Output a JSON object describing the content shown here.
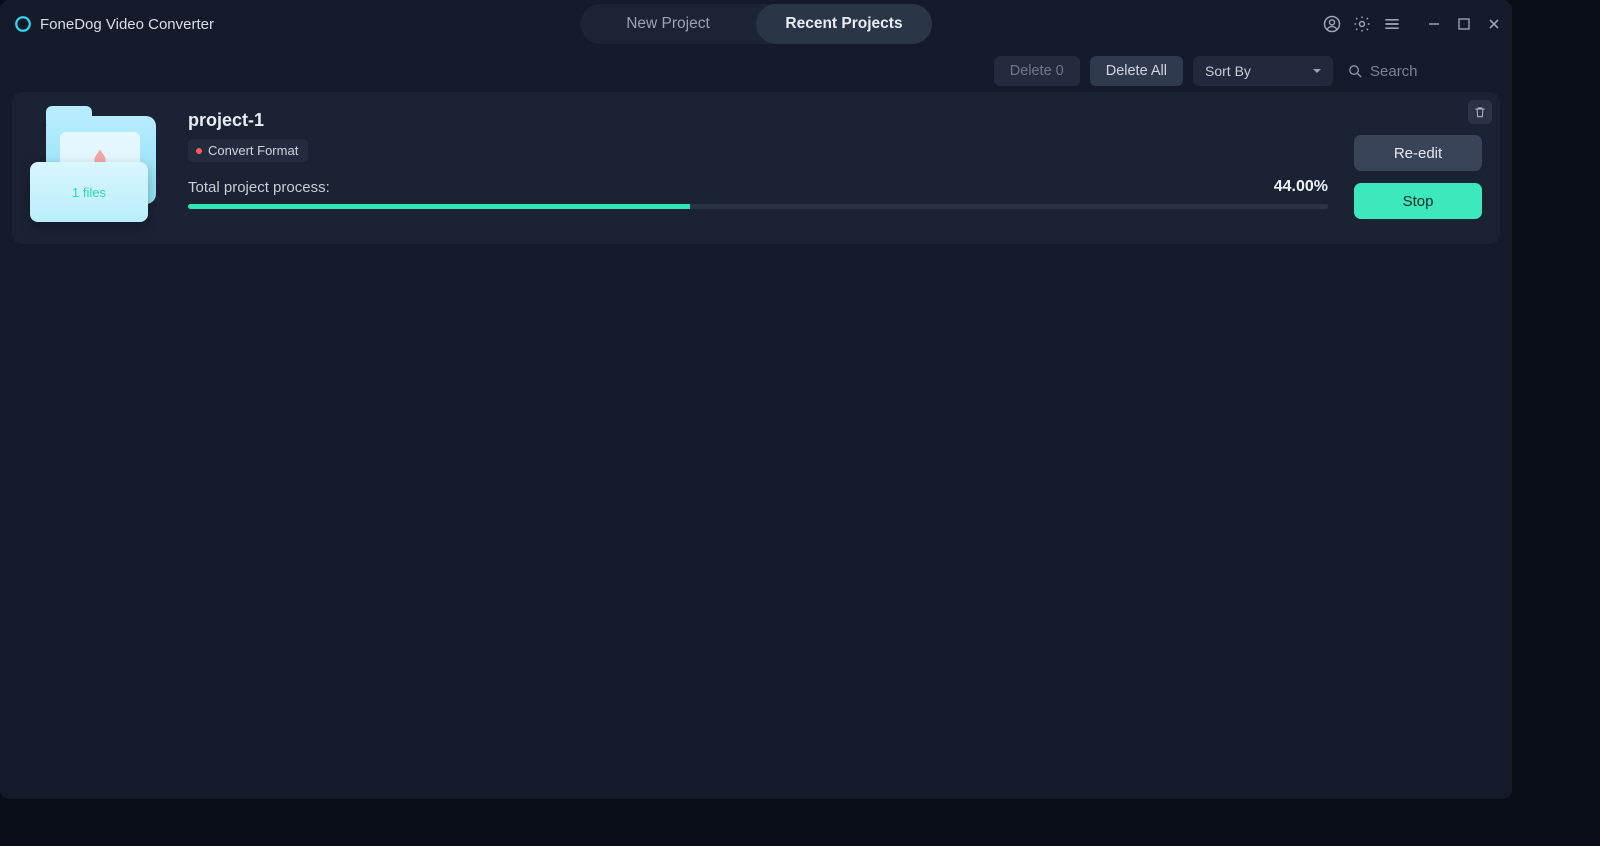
{
  "app": {
    "title": "FoneDog Video Converter"
  },
  "tabs": {
    "new_project": "New Project",
    "recent_projects": "Recent Projects"
  },
  "toolbar": {
    "delete_count_label": "Delete 0",
    "delete_all_label": "Delete All",
    "sort_by_label": "Sort By",
    "search_placeholder": "Search"
  },
  "project_card": {
    "title": "project-1",
    "tag_label": "Convert Format",
    "files_label": "1 files",
    "progress_label": "Total project process:",
    "progress_percent_text": "44.00%",
    "progress_percent_value": 44,
    "reedit_label": "Re-edit",
    "stop_label": "Stop"
  }
}
